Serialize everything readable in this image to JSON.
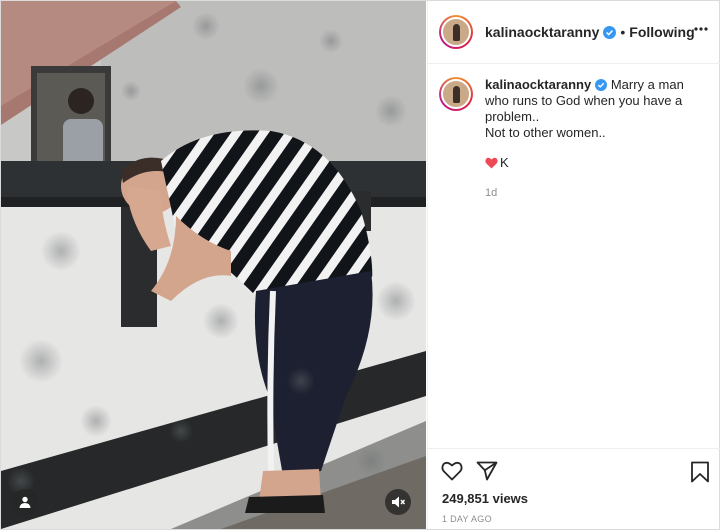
{
  "post": {
    "username": "kalinaocktaranny",
    "follow_status": "Following",
    "dot_separator": "•",
    "caption": "Marry a man who runs to God when you have a problem..\nNot to other women..",
    "comment_text": "K",
    "comment_time": "1d",
    "views": "249,851 views",
    "date": "1 DAY AGO"
  },
  "icons": {
    "verified": "verified-badge-icon",
    "more": "more-options-icon",
    "like": "heart-outline-icon",
    "share": "paper-plane-icon",
    "save": "bookmark-icon",
    "user_tag": "user-tag-icon",
    "mute": "speaker-muted-icon",
    "comment_heart": "red-heart-icon"
  },
  "colors": {
    "verified_blue": "#3897f0",
    "heart_red": "#ed4956",
    "text_primary": "#262626",
    "text_secondary": "#8e8e8e"
  }
}
